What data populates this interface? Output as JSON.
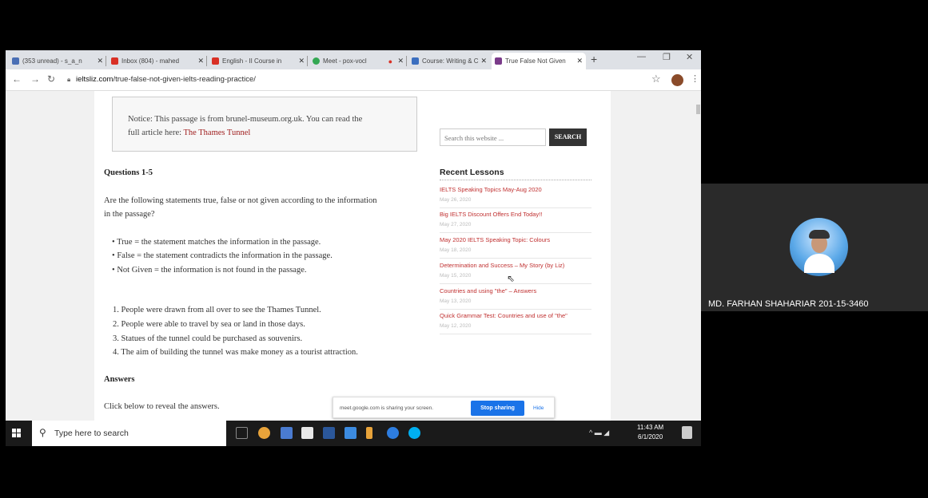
{
  "browser": {
    "tabs": [
      {
        "label": "(353 unread) - s_a_n",
        "color": "#4a6fb5"
      },
      {
        "label": "Inbox (804) - mahed",
        "color": "#d93025"
      },
      {
        "label": "English - II Course in",
        "color": "#d93025"
      },
      {
        "label": "Meet - pox-vocl",
        "color": "#34a853"
      },
      {
        "label": "Course: Writing & C",
        "color": "#3c6fbf"
      },
      {
        "label": "True False Not Given",
        "color": "#7a3b8a"
      }
    ],
    "url_host": "ieltsliz.com",
    "url_path": "/true-false-not-given-ielts-reading-practice/"
  },
  "page": {
    "notice_line1": "Notice: This passage is from brunel-museum.org.uk. You can read the",
    "notice_line2": "full article here: ",
    "notice_link": "The Thames Tunnel",
    "questions_heading": "Questions 1-5",
    "instruction_line1": "Are the following statements true, false or not given according to the information",
    "instruction_line2": "in the passage?",
    "bullets": [
      "True = the statement matches the information in the passage.",
      "False = the statement contradicts the information in the passage.",
      "Not Given = the information is not found in the passage."
    ],
    "questions": [
      "1. People were drawn from all over to see the Thames Tunnel.",
      "2. People were able to travel by sea or land in those days.",
      "3. Statues of the tunnel could be purchased as souvenirs.",
      "4. The aim of building the tunnel was make money as a tourist attraction."
    ],
    "answers_heading": "Answers",
    "reveal_text": "Click below to reveal the answers."
  },
  "sidebar": {
    "search_placeholder": "Search this website ...",
    "search_button": "SEARCH",
    "recent_title": "Recent Lessons",
    "lessons": [
      {
        "title": "IELTS Speaking Topics May-Aug 2020",
        "date": "May 26, 2020"
      },
      {
        "title": "Big IELTS Discount Offers End Today!!",
        "date": "May 27, 2020"
      },
      {
        "title": "May 2020 IELTS Speaking Topic: Colours",
        "date": "May 18, 2020"
      },
      {
        "title": "Determination and Success – My Story (by Liz)",
        "date": "May 15, 2020"
      },
      {
        "title": "Countries and using \"the\" – Answers",
        "date": "May 13, 2020"
      },
      {
        "title": "Quick Grammar Test: Countries and use of \"the\"",
        "date": "May 12, 2020"
      }
    ]
  },
  "share_bar": {
    "message": "meet.google.com is sharing your screen.",
    "stop": "Stop sharing",
    "hide": "Hide"
  },
  "taskbar": {
    "search_placeholder": "Type here to search",
    "time": "11:43 AM",
    "date": "6/1/2020"
  },
  "meet": {
    "participant_name": "MD. FARHAN SHAHARIAR 201-15-3460"
  }
}
